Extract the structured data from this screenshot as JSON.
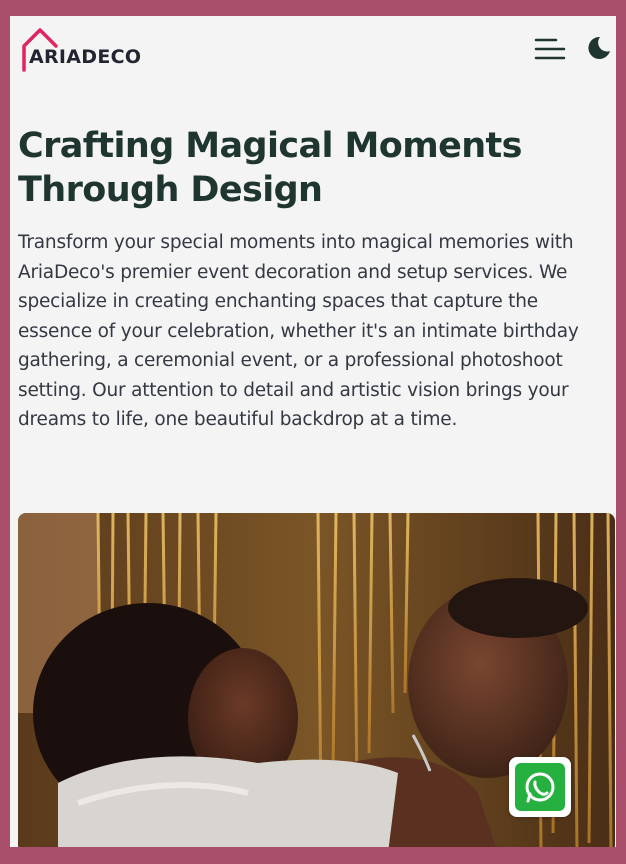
{
  "brand": {
    "name": "ARIADECO",
    "accent": "#e0245e",
    "text_color": "#222431"
  },
  "header": {
    "menu_icon": "menu-lines-icon",
    "theme_icon": "moon-icon"
  },
  "hero": {
    "title": "Crafting Magical Moments Through Design",
    "description": "Transform your special moments into magical memories with AriaDeco's premier event decoration and setup services. We specialize in creating enchanting spaces that capture the essence of your celebration, whether it's an intimate birthday gathering, a ceremonial event, or a professional photoshoot setting. Our attention to detail and artistic vision brings your dreams to life, one beautiful backdrop at a time."
  },
  "colors": {
    "frame": "#a94f6c",
    "page_bg": "#f4f4f4",
    "heading": "#1e3530",
    "whatsapp_green": "#25b03f"
  },
  "floating": {
    "whatsapp_icon": "whatsapp-icon"
  }
}
